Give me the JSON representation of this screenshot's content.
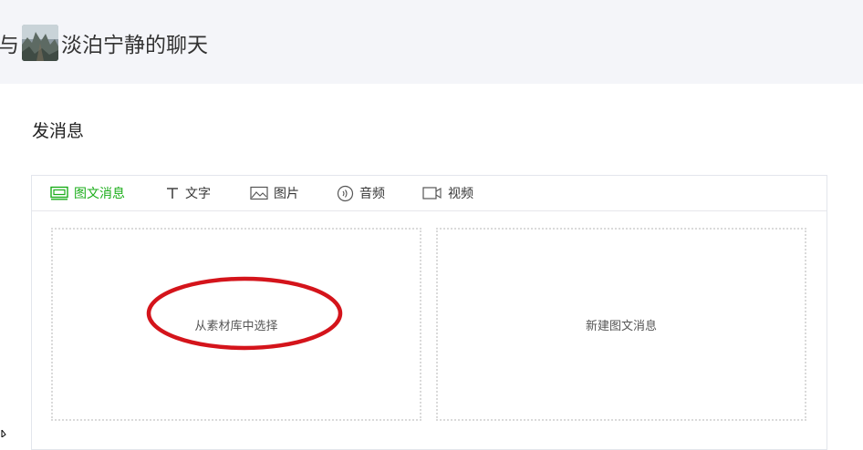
{
  "header": {
    "prefix": "与",
    "title": "淡泊宁静的聊天"
  },
  "page": {
    "section_title": "发消息"
  },
  "tabs": [
    {
      "label": "图文消息",
      "icon": "article-icon",
      "active": true
    },
    {
      "label": "文字",
      "icon": "text-icon",
      "active": false
    },
    {
      "label": "图片",
      "icon": "image-icon",
      "active": false
    },
    {
      "label": "音频",
      "icon": "audio-icon",
      "active": false
    },
    {
      "label": "视频",
      "icon": "video-icon",
      "active": false
    }
  ],
  "cards": {
    "select_from_library": "从素材库中选择",
    "new_article": "新建图文消息"
  },
  "colors": {
    "accent": "#1aad19",
    "annotation": "#d4141b"
  }
}
